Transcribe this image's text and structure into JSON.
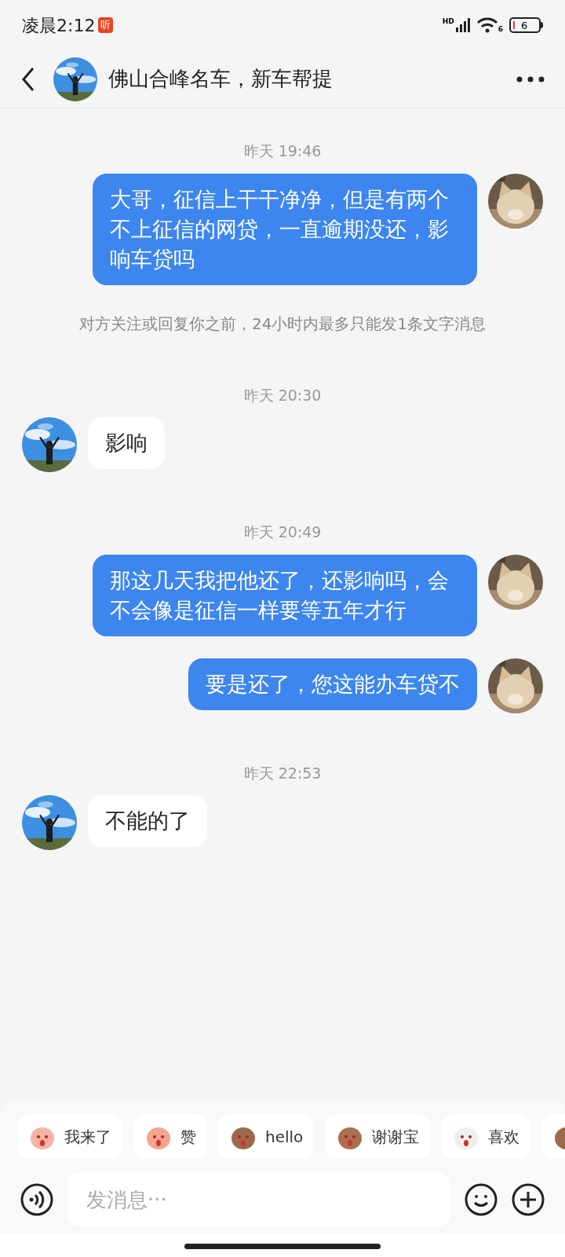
{
  "status_bar": {
    "time": "凌晨2:12",
    "app_badge": "听",
    "signal_label": "HD",
    "wifi_label": "6",
    "battery": "6"
  },
  "header": {
    "title": "佛山合峰名车，新车帮提"
  },
  "messages": [
    {
      "kind": "time",
      "text": "昨天 19:46"
    },
    {
      "kind": "message",
      "sent": true,
      "text": "大哥，征信上干干净净，但是有两个不上征信的网贷，一直逾期没还，影响车贷吗"
    },
    {
      "kind": "notice",
      "text": "对方关注或回复你之前，24小时内最多只能发1条文字消息"
    },
    {
      "kind": "time",
      "text": "昨天 20:30"
    },
    {
      "kind": "message",
      "sent": false,
      "text": "影响"
    },
    {
      "kind": "time",
      "text": "昨天 20:49"
    },
    {
      "kind": "message",
      "sent": true,
      "text": "那这几天我把他还了，还影响吗，会不会像是征信一样要等五年才行"
    },
    {
      "kind": "message",
      "sent": true,
      "text": "要是还了，您这能办车贷不"
    },
    {
      "kind": "time",
      "text": "昨天 22:53"
    },
    {
      "kind": "message",
      "sent": false,
      "text": "不能的了"
    }
  ],
  "quick_replies": [
    "我来了",
    "赞",
    "hello",
    "谢谢宝",
    "喜欢"
  ],
  "input": {
    "placeholder": "发消息···"
  }
}
